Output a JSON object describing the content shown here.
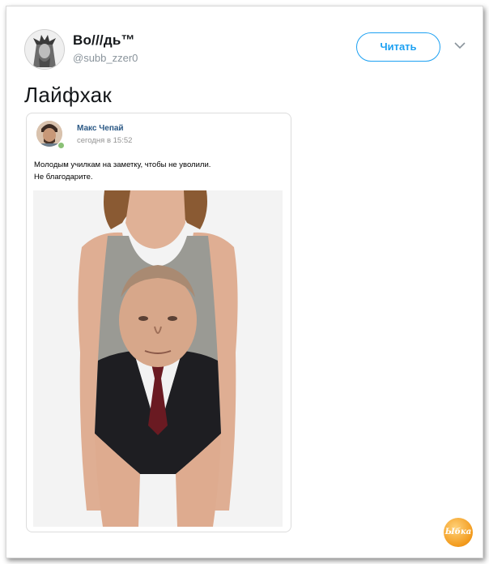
{
  "tweet": {
    "display_name": "Во///дь™",
    "handle": "@subb_zzer0",
    "follow_label": "Читать",
    "text": "Лайфхак"
  },
  "embedded_post": {
    "author": "Макс Чепай",
    "time": "сегодня в 15:52",
    "text_line1": "Молодым училкам на заметку, чтобы не уволили.",
    "text_line2": "Не благодарите."
  },
  "watermark": {
    "label": "Ыбка"
  },
  "colors": {
    "accent": "#1da1f2",
    "vk_link": "#2a5885",
    "online": "#8ac176"
  },
  "icons": {
    "chevron": "chevron-down-icon",
    "avatar": "avatar",
    "online": "online-indicator"
  }
}
